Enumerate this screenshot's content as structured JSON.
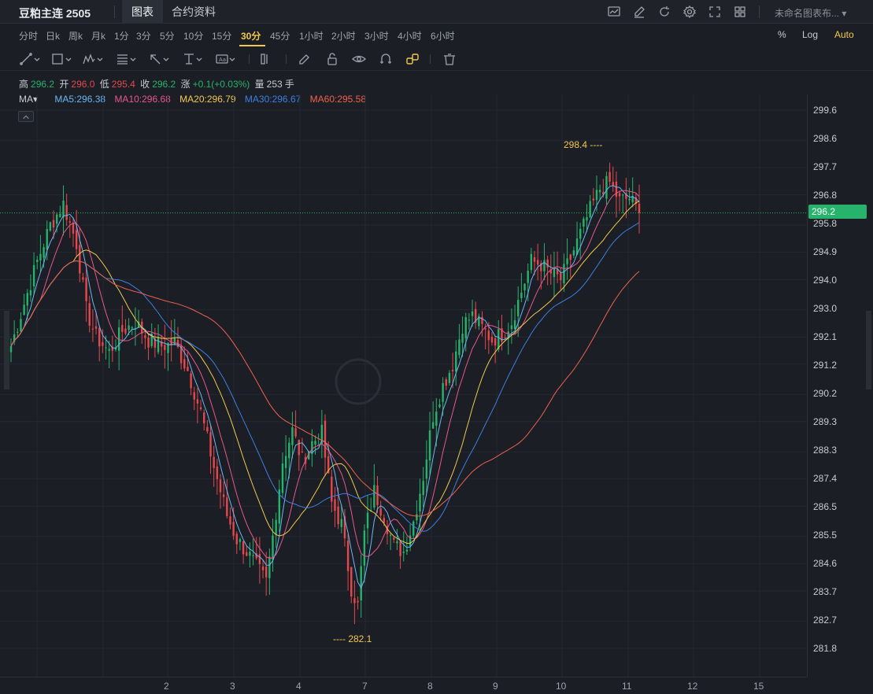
{
  "header": {
    "title": "豆粕主连 2505",
    "tabs": [
      {
        "label": "图表"
      },
      {
        "label": "合约资料"
      }
    ],
    "layout_name": "未命名图表布...",
    "icons": [
      "chart-icon",
      "draw-icon",
      "refresh-icon",
      "settings-icon",
      "fullscreen-icon",
      "layout-grid-icon"
    ]
  },
  "periods": [
    "分时",
    "日k",
    "周k",
    "月k",
    "1分",
    "3分",
    "5分",
    "10分",
    "15分",
    "30分",
    "45分",
    "1小时",
    "2小时",
    "3小时",
    "4小时",
    "6小时"
  ],
  "active_period": "30分",
  "scale": {
    "percent": "%",
    "log": "Log",
    "auto": "Auto"
  },
  "toolbar": {
    "icons": [
      "trendline-icon",
      "rectangle-icon",
      "pattern-icon",
      "fib-icon",
      "arrow-icon",
      "measure-icon",
      "text-icon",
      "pencil-icon",
      "lock-icon",
      "eye-icon",
      "magnet-icon",
      "link-icon",
      "trash-icon"
    ]
  },
  "ohlc": {
    "high_label": "高",
    "high": "296.2",
    "open_label": "开",
    "open": "296.0",
    "low_label": "低",
    "low": "295.4",
    "close_label": "收",
    "close": "296.2",
    "change_label": "涨",
    "change": "+0.1(+0.03%)",
    "volume_label": "量",
    "volume": "253",
    "volume_unit": "手"
  },
  "ma": {
    "label": "MA",
    "items": [
      {
        "text": "MA5:296.38",
        "color": "#6ab7f5"
      },
      {
        "text": "MA10:296.68",
        "color": "#e8578d"
      },
      {
        "text": "MA20:296.79",
        "color": "#f2c94c"
      },
      {
        "text": "MA30:296.67",
        "color": "#3d7fe0"
      },
      {
        "text": "MA60:295.58",
        "color": "#f0624d"
      }
    ]
  },
  "price_axis": [
    "299.6",
    "298.6",
    "297.7",
    "296.8",
    "295.8",
    "294.9",
    "294.0",
    "293.0",
    "292.1",
    "291.2",
    "290.2",
    "289.3",
    "288.3",
    "287.4",
    "286.5",
    "285.5",
    "284.6",
    "283.7",
    "282.7",
    "281.8"
  ],
  "last_price": "296.2",
  "date_axis": [
    "2",
    "3",
    "4",
    "7",
    "8",
    "9",
    "10",
    "11",
    "12",
    "15"
  ],
  "annotations": {
    "high": "298.4",
    "low": "282.1"
  },
  "colors": {
    "up": "#27b36b",
    "down": "#e5484d",
    "accent": "#f2c94c",
    "background": "#1b1e25"
  },
  "chart_data": {
    "type": "candlestick",
    "y_range": [
      281.5,
      300.0
    ],
    "close_path": [
      [
        0,
        291.8
      ],
      [
        4,
        293.2
      ],
      [
        8,
        294.6
      ],
      [
        12,
        295.8
      ],
      [
        16,
        296.5
      ],
      [
        20,
        295.2
      ],
      [
        23,
        293.0
      ],
      [
        26,
        292.1
      ],
      [
        30,
        291.6
      ],
      [
        34,
        292.3
      ],
      [
        38,
        292.6
      ],
      [
        42,
        292.0
      ],
      [
        46,
        291.8
      ],
      [
        50,
        291.9
      ],
      [
        54,
        291.0
      ],
      [
        58,
        289.6
      ],
      [
        62,
        287.8
      ],
      [
        66,
        286.2
      ],
      [
        69,
        285.4
      ],
      [
        72,
        285.0
      ],
      [
        75,
        284.5
      ],
      [
        78,
        284.0
      ],
      [
        80,
        285.5
      ],
      [
        83,
        288.0
      ],
      [
        86,
        289.0
      ],
      [
        89,
        288.0
      ],
      [
        92,
        288.6
      ],
      [
        95,
        288.9
      ],
      [
        98,
        286.6
      ],
      [
        101,
        285.9
      ],
      [
        104,
        283.8
      ],
      [
        106,
        283.2
      ],
      [
        108,
        285.6
      ],
      [
        111,
        287.0
      ],
      [
        114,
        286.2
      ],
      [
        117,
        285.2
      ],
      [
        120,
        285.0
      ],
      [
        123,
        286.0
      ],
      [
        126,
        287.5
      ],
      [
        129,
        289.5
      ],
      [
        132,
        290.5
      ],
      [
        135,
        291.2
      ],
      [
        138,
        292.5
      ],
      [
        141,
        292.8
      ],
      [
        144,
        292.4
      ],
      [
        147,
        292.0
      ],
      [
        150,
        292.2
      ],
      [
        153,
        292.6
      ],
      [
        156,
        293.6
      ],
      [
        159,
        294.6
      ],
      [
        162,
        294.5
      ],
      [
        165,
        294.2
      ],
      [
        168,
        294.0
      ],
      [
        171,
        294.7
      ],
      [
        174,
        295.5
      ],
      [
        177,
        296.3
      ],
      [
        180,
        297.0
      ],
      [
        183,
        297.2
      ],
      [
        186,
        296.6
      ],
      [
        189,
        296.7
      ],
      [
        192,
        296.2
      ]
    ]
  }
}
